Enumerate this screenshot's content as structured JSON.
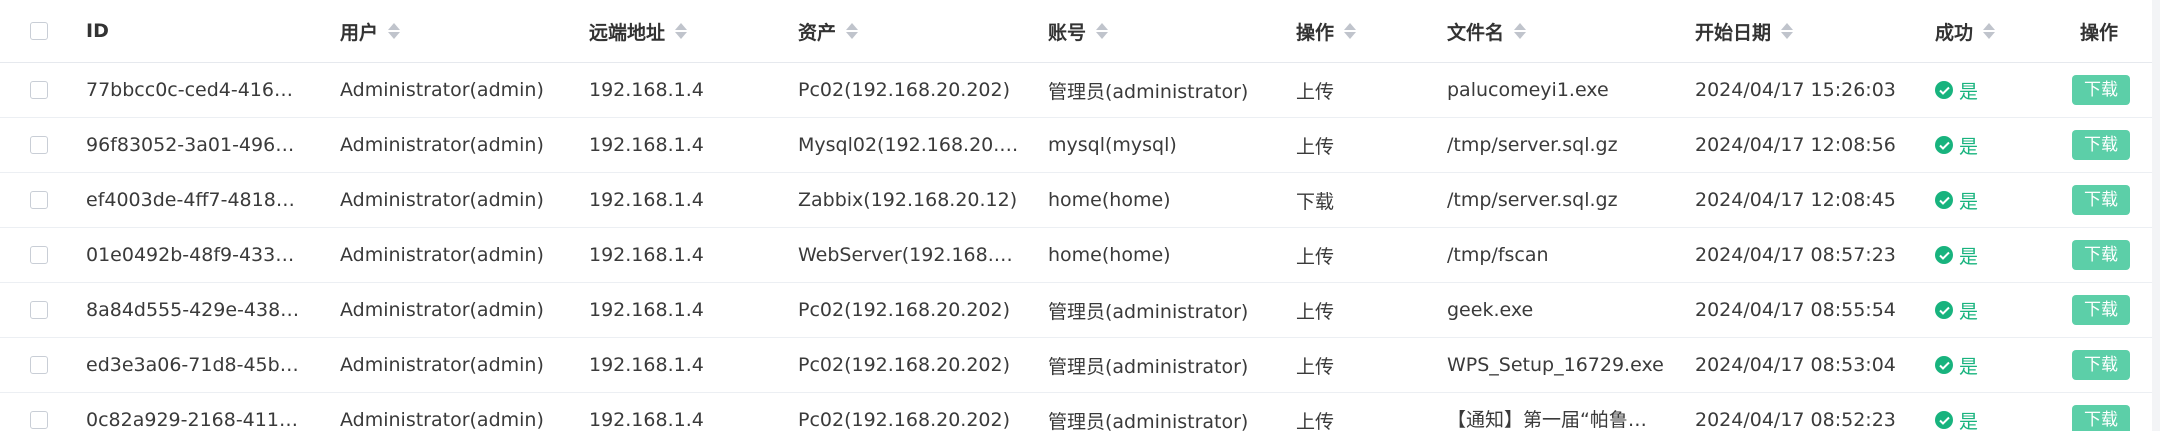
{
  "columns": {
    "id": "ID",
    "user": "用户",
    "remote": "远端地址",
    "asset": "资产",
    "account": "账号",
    "operation": "操作",
    "filename": "文件名",
    "start_date": "开始日期",
    "success": "成功",
    "actions": "操作"
  },
  "download_label": "下载",
  "success_yes": "是",
  "colors": {
    "success": "#18b37e",
    "button": "#5ccfa8"
  },
  "rows": [
    {
      "id": "77bbcc0c-ced4-416c-…",
      "user": "Administrator(admin)",
      "remote": "192.168.1.4",
      "asset": "Pc02(192.168.20.202)",
      "account": "管理员(administrator)",
      "operation": "上传",
      "filename": "palucomeyi1.exe",
      "date": "2024/04/17 15:26:03"
    },
    {
      "id": "96f83052-3a01-4965-…",
      "user": "Administrator(admin)",
      "remote": "192.168.1.4",
      "asset": "Mysql02(192.168.20.52)",
      "account": "mysql(mysql)",
      "operation": "上传",
      "filename": "/tmp/server.sql.gz",
      "date": "2024/04/17 12:08:56"
    },
    {
      "id": "ef4003de-4ff7-4818-b…",
      "user": "Administrator(admin)",
      "remote": "192.168.1.4",
      "asset": "Zabbix(192.168.20.12)",
      "account": "home(home)",
      "operation": "下载",
      "filename": "/tmp/server.sql.gz",
      "date": "2024/04/17 12:08:45"
    },
    {
      "id": "01e0492b-48f9-433d-…",
      "user": "Administrator(admin)",
      "remote": "192.168.1.4",
      "asset": "WebServer(192.168.2…",
      "account": "home(home)",
      "operation": "上传",
      "filename": "/tmp/fscan",
      "date": "2024/04/17 08:57:23"
    },
    {
      "id": "8a84d555-429e-438f-…",
      "user": "Administrator(admin)",
      "remote": "192.168.1.4",
      "asset": "Pc02(192.168.20.202)",
      "account": "管理员(administrator)",
      "operation": "上传",
      "filename": "geek.exe",
      "date": "2024/04/17 08:55:54"
    },
    {
      "id": "ed3e3a06-71d8-45b6-…",
      "user": "Administrator(admin)",
      "remote": "192.168.1.4",
      "asset": "Pc02(192.168.20.202)",
      "account": "管理员(administrator)",
      "operation": "上传",
      "filename": "WPS_Setup_16729.exe",
      "date": "2024/04/17 08:53:04"
    },
    {
      "id": "0c82a929-2168-411e-…",
      "user": "Administrator(admin)",
      "remote": "192.168.1.4",
      "asset": "Pc02(192.168.20.202)",
      "account": "管理员(administrator)",
      "operation": "上传",
      "filename": "【通知】第一届“帕鲁…",
      "date": "2024/04/17 08:52:23"
    }
  ]
}
